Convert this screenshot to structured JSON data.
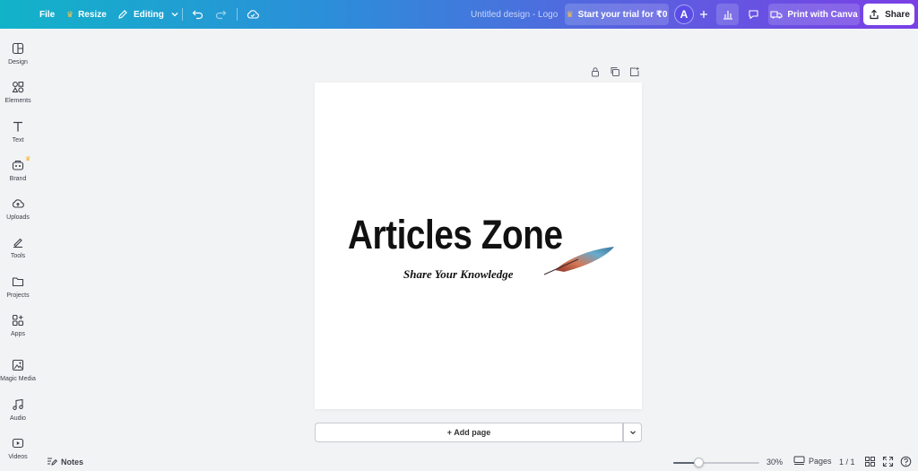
{
  "topbar": {
    "file_label": "File",
    "resize_label": "Resize",
    "editing_label": "Editing",
    "design_title": "Untitled design - Logo",
    "trial_label": "Start your trial for ₹0",
    "avatar_initial": "A",
    "print_label": "Print with Canva",
    "share_label": "Share"
  },
  "sidebar": {
    "items": [
      {
        "label": "Design",
        "icon": "design-icon"
      },
      {
        "label": "Elements",
        "icon": "elements-icon"
      },
      {
        "label": "Text",
        "icon": "text-icon"
      },
      {
        "label": "Brand",
        "icon": "brand-icon"
      },
      {
        "label": "Uploads",
        "icon": "uploads-icon"
      },
      {
        "label": "Tools",
        "icon": "tools-icon"
      },
      {
        "label": "Projects",
        "icon": "projects-icon"
      },
      {
        "label": "Apps",
        "icon": "apps-icon"
      },
      {
        "label": "Magic Media",
        "icon": "magic-media-icon"
      },
      {
        "label": "Audio",
        "icon": "audio-icon"
      },
      {
        "label": "Videos",
        "icon": "videos-icon"
      }
    ]
  },
  "canvas": {
    "logo_title": "Articles Zone",
    "logo_subtitle": "Share Your Knowledge",
    "add_page_label": "+ Add page"
  },
  "bottombar": {
    "notes_label": "Notes",
    "zoom_value": "30%",
    "zoom_fraction": 0.3,
    "pages_label": "Pages",
    "page_count": "1 / 1"
  },
  "colors": {
    "gradient_start": "#12b3c9",
    "gradient_end": "#7a3fe6",
    "background": "#f2f3f5",
    "page": "#ffffff"
  }
}
